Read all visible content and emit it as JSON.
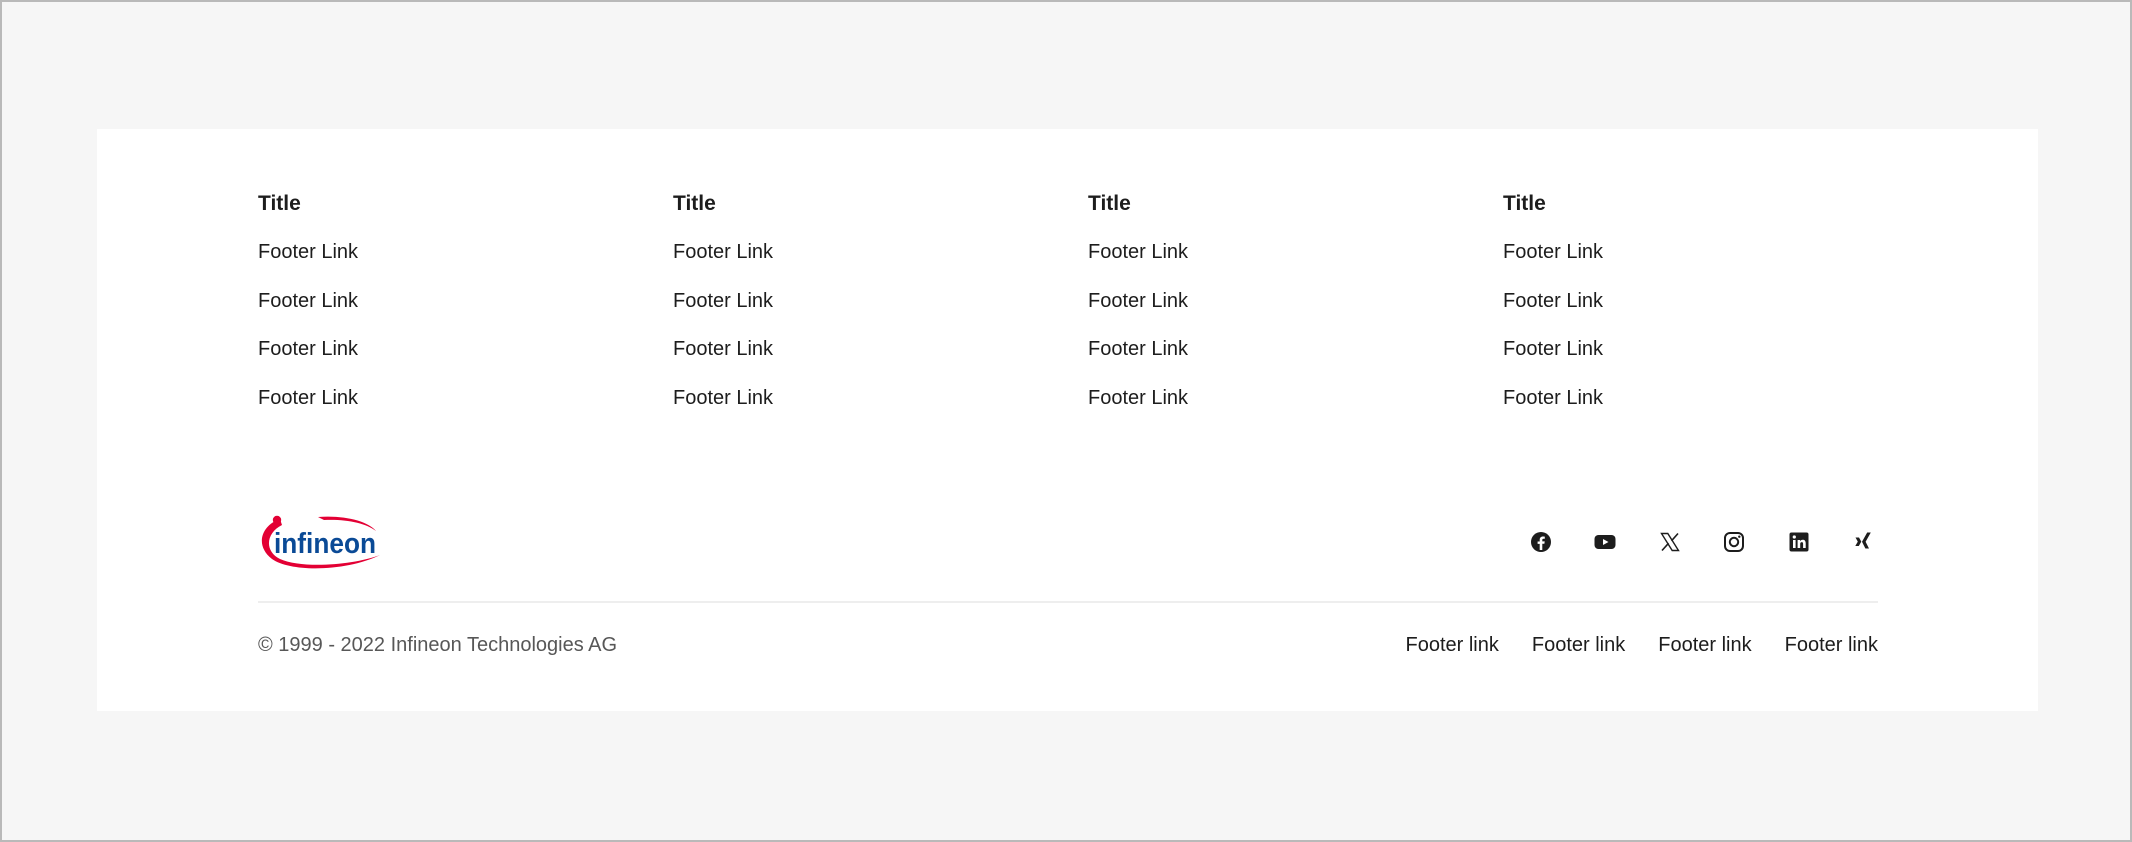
{
  "columns": [
    {
      "title": "Title",
      "links": [
        "Footer Link",
        "Footer Link",
        "Footer Link",
        "Footer Link"
      ]
    },
    {
      "title": "Title",
      "links": [
        "Footer Link",
        "Footer Link",
        "Footer Link",
        "Footer Link"
      ]
    },
    {
      "title": "Title",
      "links": [
        "Footer Link",
        "Footer Link",
        "Footer Link",
        "Footer Link"
      ]
    },
    {
      "title": "Title",
      "links": [
        "Footer Link",
        "Footer Link",
        "Footer Link",
        "Footer Link"
      ]
    }
  ],
  "brand": {
    "logo_text": "infineon",
    "colors": {
      "blue": "#0a4a96",
      "red": "#e30034"
    }
  },
  "social": [
    {
      "icon": "facebook-icon"
    },
    {
      "icon": "youtube-icon"
    },
    {
      "icon": "x-icon"
    },
    {
      "icon": "instagram-icon"
    },
    {
      "icon": "linkedin-icon"
    },
    {
      "icon": "xing-icon"
    }
  ],
  "copyright": "© 1999 - 2022 Infineon Technologies AG",
  "legal_links": [
    "Footer link",
    "Footer link",
    "Footer link",
    "Footer link"
  ]
}
